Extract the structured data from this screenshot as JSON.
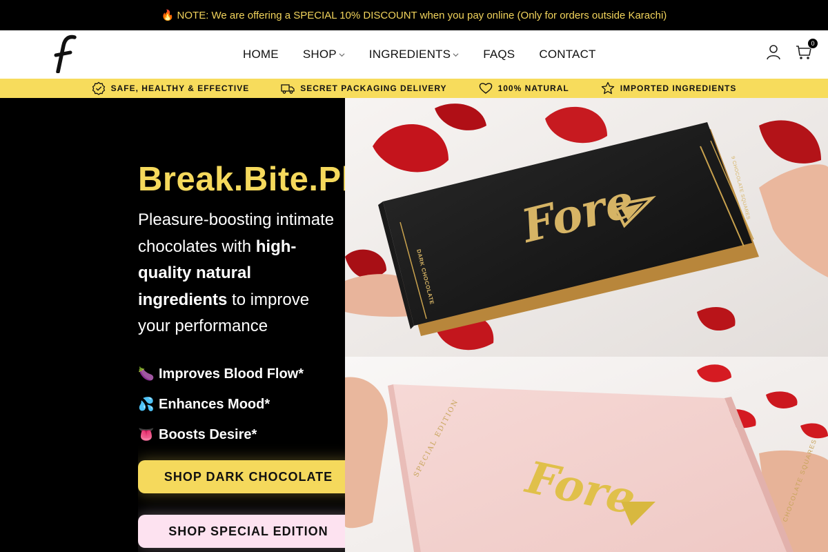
{
  "announcement": {
    "icon": "fire-icon",
    "text": "🔥 NOTE: We are offering a SPECIAL 10% DISCOUNT when you pay online (Only for orders outside Karachi)"
  },
  "header": {
    "logo_letter": "f",
    "nav": [
      {
        "label": "HOME",
        "has_dropdown": false
      },
      {
        "label": "SHOP",
        "has_dropdown": true
      },
      {
        "label": "INGREDIENTS",
        "has_dropdown": true
      },
      {
        "label": "FAQS",
        "has_dropdown": false
      },
      {
        "label": "CONTACT",
        "has_dropdown": false
      }
    ],
    "account_icon": "user-icon",
    "cart_icon": "shopping-bag-icon",
    "cart_count": "0"
  },
  "usp_bar": {
    "background": "#f7dc5c",
    "items": [
      {
        "icon": "verified-badge-icon",
        "label": "SAFE, HEALTHY & EFFECTIVE"
      },
      {
        "icon": "truck-icon",
        "label": "SECRET PACKAGING DELIVERY"
      },
      {
        "icon": "heart-icon",
        "label": "100% NATURAL"
      },
      {
        "icon": "star-icon",
        "label": "IMPORTED INGREDIENTS"
      }
    ]
  },
  "hero": {
    "headline": "Break.Bite.Play",
    "sub_1": "Pleasure-boosting intimate chocolates with ",
    "sub_bold": "high-quality natural ingredients",
    "sub_2": " to improve your performance",
    "benefits": [
      {
        "emoji": "🍆",
        "label": "Improves Blood Flow*"
      },
      {
        "emoji": "💦",
        "label": "Enhances Mood*"
      },
      {
        "emoji": "👅",
        "label": "Boosts Desire*"
      }
    ],
    "cta_dark": "SHOP DARK CHOCOLATE",
    "cta_special": "SHOP SPECIAL EDITION",
    "accent_color": "#f5d95c",
    "special_color": "#fde2f0",
    "box_black": {
      "brand": "Fore",
      "side_text": "DARK CHOCOLATE",
      "side_text_2": "9 CHOCOLATE SQUARES"
    },
    "box_pink": {
      "brand": "Fore",
      "side_text": "SPECIAL EDITION",
      "side_text_2": "CHOCOLATE SQUARES"
    }
  }
}
